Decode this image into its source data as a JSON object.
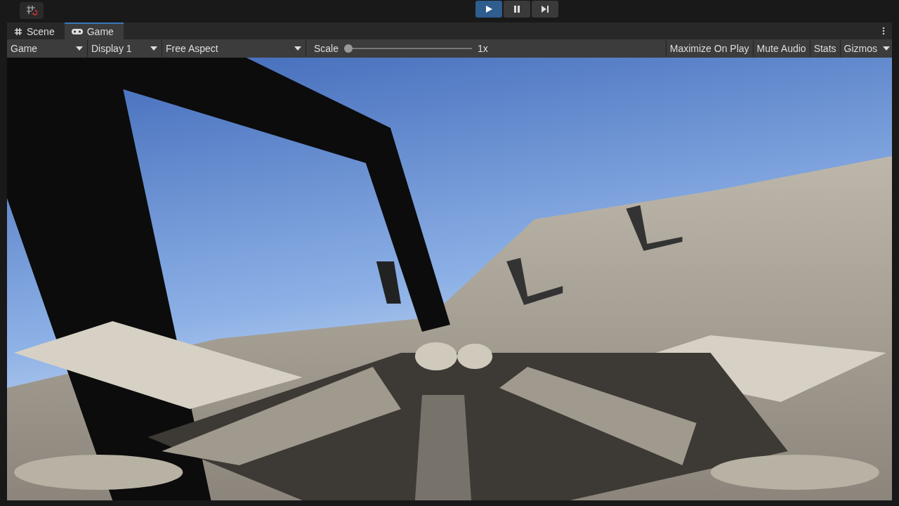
{
  "play_controls": [
    {
      "kind": "play",
      "selected": true
    },
    {
      "kind": "pause",
      "selected": false
    },
    {
      "kind": "step",
      "selected": false
    }
  ],
  "tabs": [
    {
      "label": "Scene",
      "kind": "scene",
      "selected": false
    },
    {
      "label": "Game",
      "kind": "game",
      "selected": true
    }
  ],
  "game_toolbar": {
    "view_dropdown": "Game",
    "display_dropdown": "Display 1",
    "aspect_dropdown": "Free Aspect",
    "scale": {
      "label": "Scale",
      "level": 0,
      "reading": "1x"
    },
    "toggles": [
      {
        "label": "Maximize On Play",
        "on": false
      },
      {
        "label": "Mute Audio",
        "on": false
      },
      {
        "label": "Stats",
        "on": false
      },
      {
        "label": "Gizmos",
        "on": false
      }
    ]
  }
}
